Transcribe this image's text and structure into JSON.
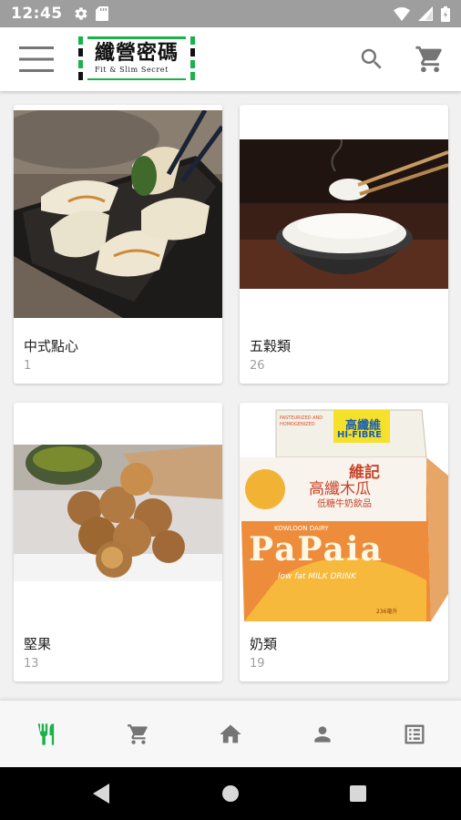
{
  "status_bar": {
    "time": "12:45"
  },
  "app_bar": {
    "logo_title": "纖營密碼",
    "logo_subtitle": "Fit & Slim Secret",
    "brand_green": "#1bb24b"
  },
  "categories": [
    {
      "name": "中式點心",
      "count": "1"
    },
    {
      "name": "五穀類",
      "count": "26"
    },
    {
      "name": "堅果",
      "count": "13"
    },
    {
      "name": "奶類",
      "count": "19"
    }
  ],
  "product_art": {
    "milk_tag": "高纖維",
    "milk_tag_en": "HI-FIBRE",
    "milk_brand": "維記",
    "milk_flavor": "高纖木瓜",
    "milk_desc": "低糖牛奶飲品",
    "milk_dairy": "KOWLOON DAIRY",
    "milk_product": "PaPaia",
    "milk_drink": "low fat MILK DRINK",
    "milk_volume": "236毫升",
    "milk_badge": "PASTEURIZED AND HOMOGENIZED"
  },
  "bottom_nav": {
    "active": "food",
    "active_color": "#1bb24b",
    "inactive_color": "#757575",
    "items": [
      "food-icon",
      "cart-icon",
      "home-icon",
      "person-icon",
      "list-icon"
    ]
  }
}
